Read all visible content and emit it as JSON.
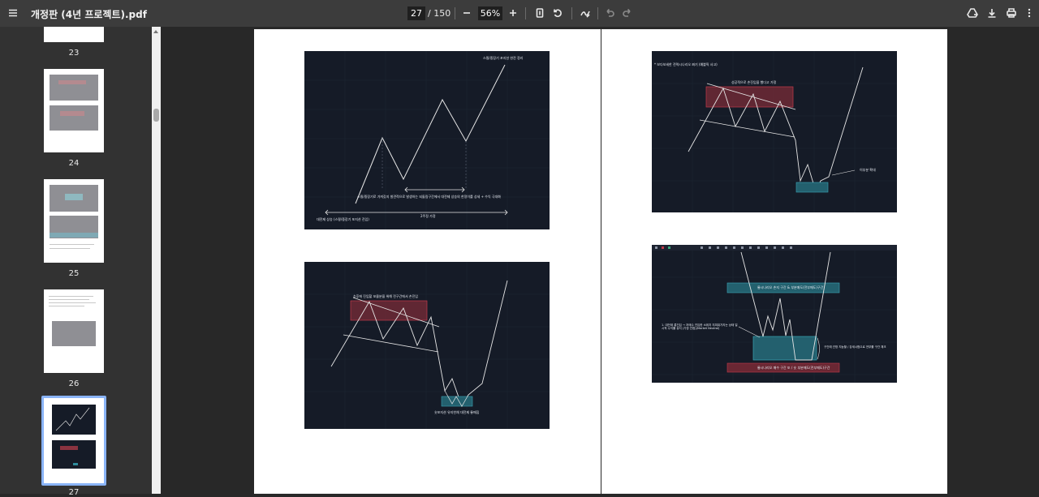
{
  "toolbar": {
    "title": "개정판 (4년 프로젝트).pdf",
    "current_page": "27",
    "total_pages": "/ 150",
    "zoom": "56%",
    "icons": [
      "menu-icon",
      "zoom-out-icon",
      "zoom-in-icon",
      "fit-page-icon",
      "rotate-icon",
      "draw-icon",
      "undo-icon",
      "redo-icon",
      "drive-icon",
      "download-icon",
      "print-icon",
      "more-icon"
    ]
  },
  "sidebar": {
    "thumbnails": [
      {
        "number": "23"
      },
      {
        "number": "24"
      },
      {
        "number": "25"
      },
      {
        "number": "26"
      },
      {
        "number": "27",
        "selected": true
      }
    ]
  },
  "charts": {
    "c1": {
      "top_right": "스윙/중장기 포지션 완전 정리",
      "middle": "스윙/중장기로 가져갔지 발견적으로 발생하는 되돌림구간에서 대전제 상승의 한정이를 상세 + 수익 극대화",
      "span": "2주정 가정",
      "bottom_left": "대전제 상승 (스윙/중장기 포지션 진입)"
    },
    "c2": {
      "top": "추후에 진입할 포몰분을 위해 전구간에서 손진입",
      "bottom": "숏포지션 유지한채 대전제 롱매집"
    },
    "c3": {
      "top_left": "* 보다보세한 전력시나리오 짜기 (예쁠픽 사고)",
      "top": "성공적으로 손진입을 했다고 가정",
      "right": "이부분 확대"
    },
    "c4": {
      "box_top": "롱시나리오 손지 구간 & 부분매도(전부매도)구간",
      "left_note": "1. 대전제 롱진입 → 저매수 진입한 소위지 지피워가지는 상태 일시적 수익률 유지 (가장 관점)(Market Neutral)",
      "right_note": "구간에 관망 지능할 / 강세시험으로 전부를 구간 체크",
      "box_bottom": "롱시나리오 매수 구간 또 / 숏 부분매도(전부매도)구간"
    }
  },
  "colors": {
    "toolbar": "#3c3c3c",
    "sidebar": "#323232",
    "viewer": "#282828",
    "chart_bg": "#151b27",
    "red_zone": "#c0394a",
    "teal_zone": "#2f8c9c",
    "selected_thumb": "#8ab4f8"
  }
}
